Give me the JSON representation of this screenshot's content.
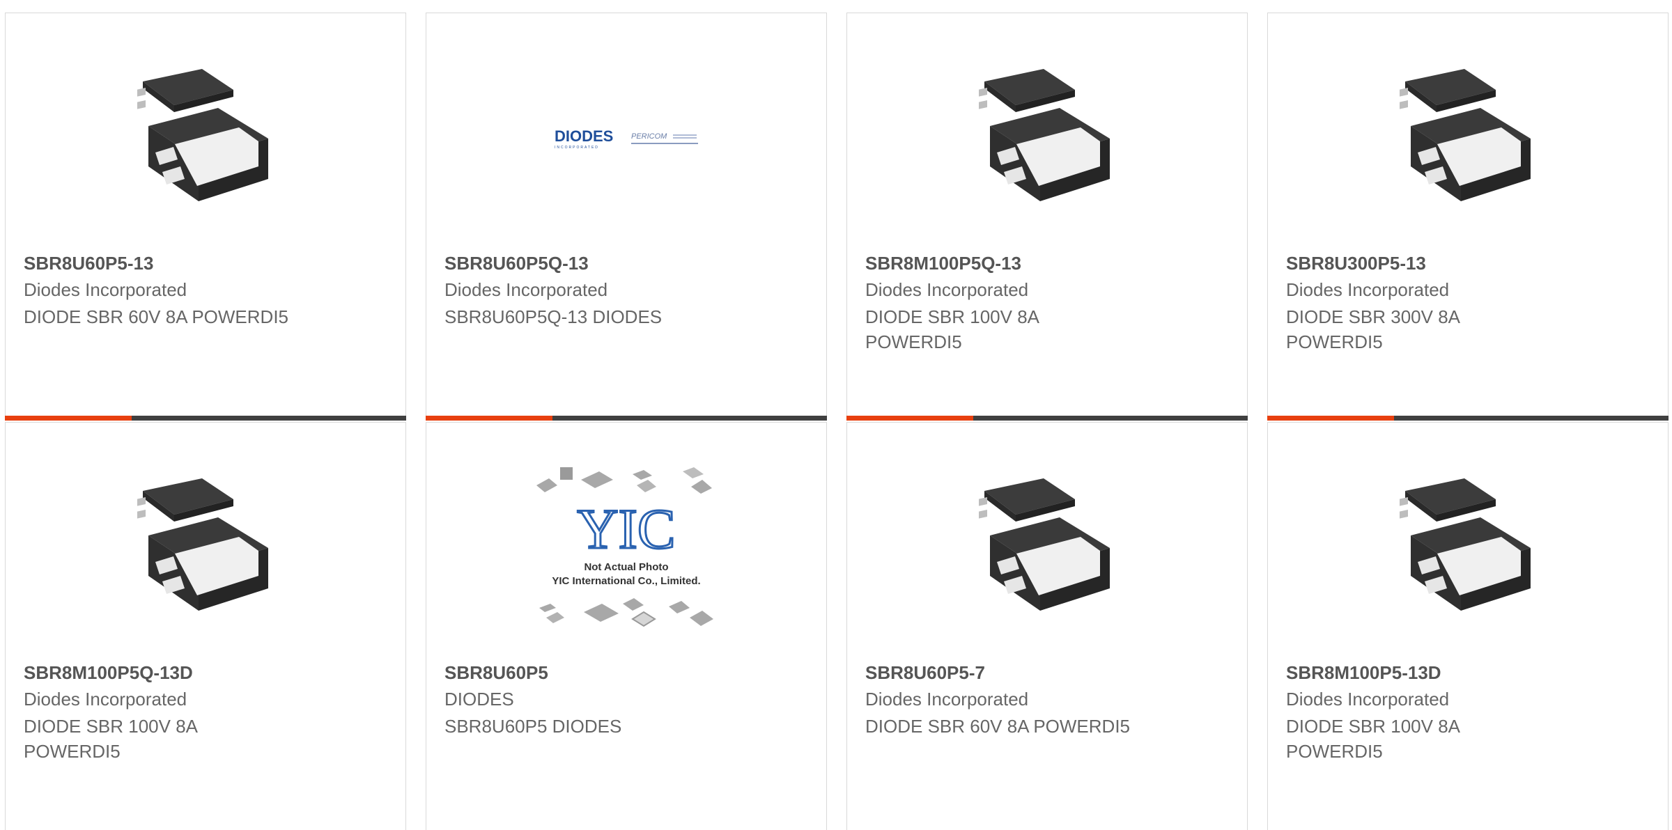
{
  "colors": {
    "accent": "#e8400f",
    "bar": "#404040",
    "title": "#555555",
    "text": "#666666"
  },
  "products": [
    {
      "part": "SBR8U60P5-13",
      "manufacturer": "Diodes Incorporated",
      "description": "DIODE SBR 60V 8A POWERDI5",
      "image": "powerdi5-package-icon"
    },
    {
      "part": "SBR8U60P5Q-13",
      "manufacturer": "Diodes Incorporated",
      "description": "SBR8U60P5Q-13 DIODES",
      "image": "diodes-pericom-logo",
      "logo": {
        "brand": "DIODES",
        "tagline": "INCORPORATED",
        "partner": "PERICOM"
      }
    },
    {
      "part": "SBR8M100P5Q-13",
      "manufacturer": "Diodes Incorporated",
      "description": "DIODE SBR 100V 8A POWERDI5",
      "image": "powerdi5-package-icon"
    },
    {
      "part": "SBR8U300P5-13",
      "manufacturer": "Diodes Incorporated",
      "description": "DIODE SBR 300V 8A POWERDI5",
      "image": "powerdi5-package-icon"
    },
    {
      "part": "SBR8M100P5Q-13D",
      "manufacturer": "Diodes Incorporated",
      "description": "DIODE SBR 100V 8A POWERDI5",
      "image": "powerdi5-package-icon"
    },
    {
      "part": "SBR8U60P5",
      "manufacturer": "DIODES",
      "description": "SBR8U60P5 DIODES",
      "image": "not-actual-photo-placeholder",
      "placeholder": {
        "logo": "YIC",
        "line1": "Not Actual Photo",
        "line2": "YIC International Co., Limited."
      }
    },
    {
      "part": "SBR8U60P5-7",
      "manufacturer": "Diodes Incorporated",
      "description": "DIODE SBR 60V 8A POWERDI5",
      "image": "powerdi5-package-icon"
    },
    {
      "part": "SBR8M100P5-13D",
      "manufacturer": "Diodes Incorporated",
      "description": "DIODE SBR 100V 8A POWERDI5",
      "image": "powerdi5-package-icon"
    }
  ]
}
